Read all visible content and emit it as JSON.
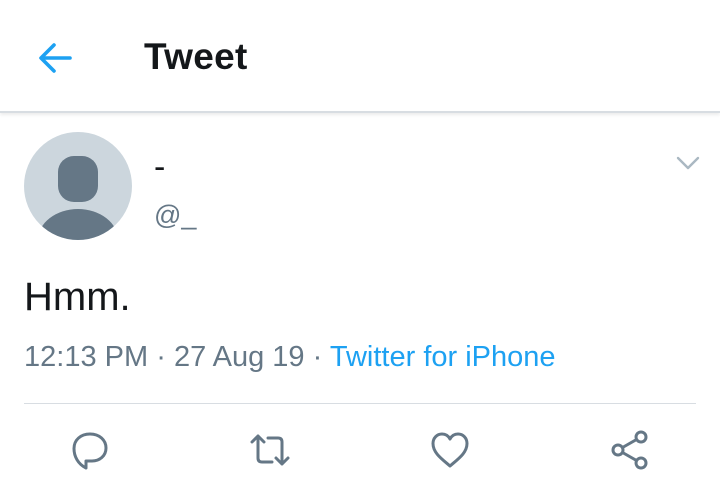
{
  "header": {
    "back_icon": "arrow-left-icon",
    "title": "Tweet"
  },
  "tweet": {
    "author": {
      "display_name": "-",
      "handle": "@_",
      "avatar_icon": "default-avatar-icon"
    },
    "text": "Hmm.",
    "time": "12:13 PM",
    "date": "27 Aug 19",
    "separator": "·",
    "source": "Twitter for iPhone",
    "menu_icon": "chevron-down-icon"
  },
  "actions": [
    {
      "name": "reply",
      "icon": "reply-icon"
    },
    {
      "name": "retweet",
      "icon": "retweet-icon"
    },
    {
      "name": "like",
      "icon": "heart-icon"
    },
    {
      "name": "share",
      "icon": "share-icon"
    }
  ],
  "colors": {
    "accent": "#1da1f2",
    "text_primary": "#14171a",
    "text_secondary": "#657786",
    "avatar_bg": "#ccd6dd",
    "avatar_fg": "#657786",
    "divider": "#d8dde2"
  }
}
